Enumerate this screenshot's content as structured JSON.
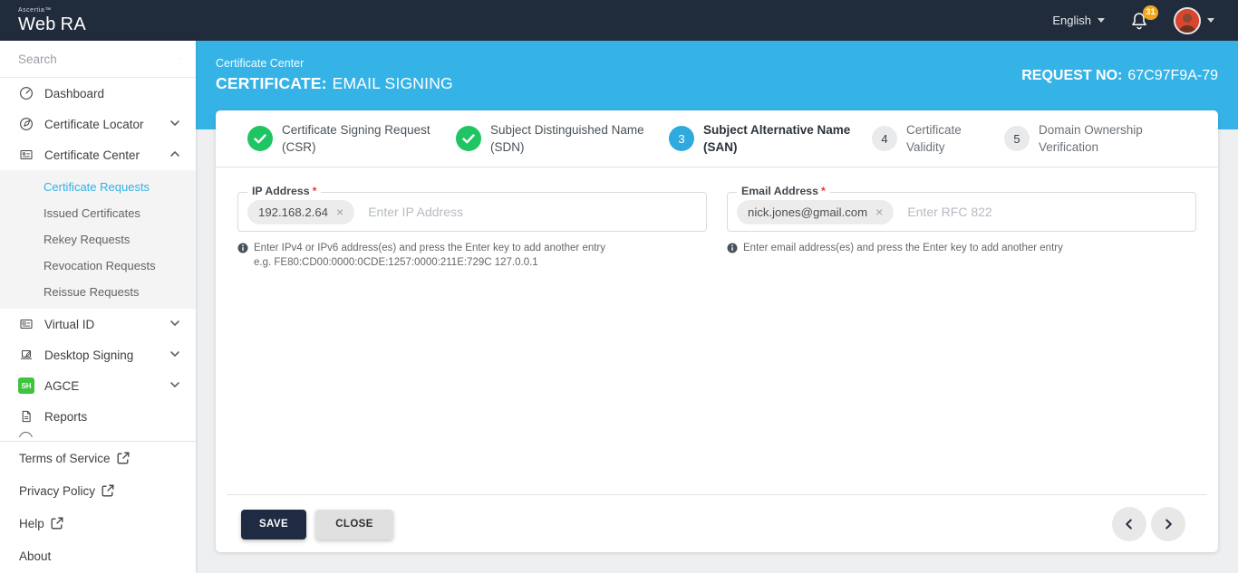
{
  "colors": {
    "topbar_bg": "#202b3b",
    "header_blue": "#36b3e6",
    "active_link_cyan": "#33b1e4",
    "success_green": "#1fc463",
    "badge_orange": "#f2a51e",
    "save_button_navy": "#1f2b42"
  },
  "topbar": {
    "brand_small": "Ascertia™",
    "brand_web": "Web",
    "brand_ra": "RA",
    "language": "English",
    "notification_count": "31"
  },
  "sidebar": {
    "search_placeholder": "Search",
    "items": [
      {
        "label": "Dashboard",
        "icon": "gauge-icon"
      },
      {
        "label": "Certificate Locator",
        "icon": "compass-icon"
      },
      {
        "label": "Certificate Center",
        "icon": "certificate-card-icon"
      },
      {
        "label": "Virtual ID",
        "icon": "id-card-icon"
      },
      {
        "label": "Desktop Signing",
        "icon": "laptop-pen-icon"
      },
      {
        "label": "AGCE",
        "icon": "sh-badge-icon",
        "badge_text": "SH"
      },
      {
        "label": "Reports",
        "icon": "document-icon"
      }
    ],
    "certificate_center_children": [
      {
        "label": "Certificate Requests",
        "active": true
      },
      {
        "label": "Issued Certificates"
      },
      {
        "label": "Rekey Requests"
      },
      {
        "label": "Revocation Requests"
      },
      {
        "label": "Reissue Requests"
      }
    ],
    "footer_links": [
      {
        "label": "Terms of Service",
        "external": true
      },
      {
        "label": "Privacy Policy",
        "external": true
      },
      {
        "label": "Help",
        "external": true
      },
      {
        "label": "About",
        "external": false
      }
    ]
  },
  "header": {
    "breadcrumb": "Certificate Center",
    "title_prefix": "CERTIFICATE:",
    "title_text": "EMAIL SIGNING",
    "request_label": "REQUEST NO:",
    "request_value": "67C97F9A-79"
  },
  "stepper": {
    "steps": [
      {
        "state": "complete",
        "line1": "Certificate Signing Request",
        "line2": "(CSR)"
      },
      {
        "state": "complete",
        "line1": "Subject Distinguished Name",
        "line2": "(SDN)"
      },
      {
        "number": "3",
        "state": "active",
        "line1": "Subject Alternative Name",
        "line2": "(SAN)"
      },
      {
        "number": "4",
        "state": "upcoming",
        "line1": "Certificate",
        "line2": "Validity"
      },
      {
        "number": "5",
        "state": "upcoming",
        "line1": "Domain Ownership",
        "line2": "Verification"
      }
    ]
  },
  "form": {
    "ip": {
      "label": "IP Address",
      "required_mark": "*",
      "chips": [
        "192.168.2.64"
      ],
      "chip_remove": "×",
      "placeholder": "Enter IP Address",
      "helper": "Enter IPv4 or IPv6 address(es) and press the Enter key to add another entry e.g. FE80:CD00:0000:0CDE:1257:0000:211E:729C 127.0.0.1"
    },
    "email": {
      "label": "Email Address",
      "required_mark": "*",
      "chips": [
        "nick.jones@gmail.com"
      ],
      "chip_remove": "×",
      "placeholder": "Enter RFC 822",
      "helper": "Enter email address(es) and press the Enter key to add another entry"
    }
  },
  "actions": {
    "save": "SAVE",
    "close": "CLOSE"
  }
}
